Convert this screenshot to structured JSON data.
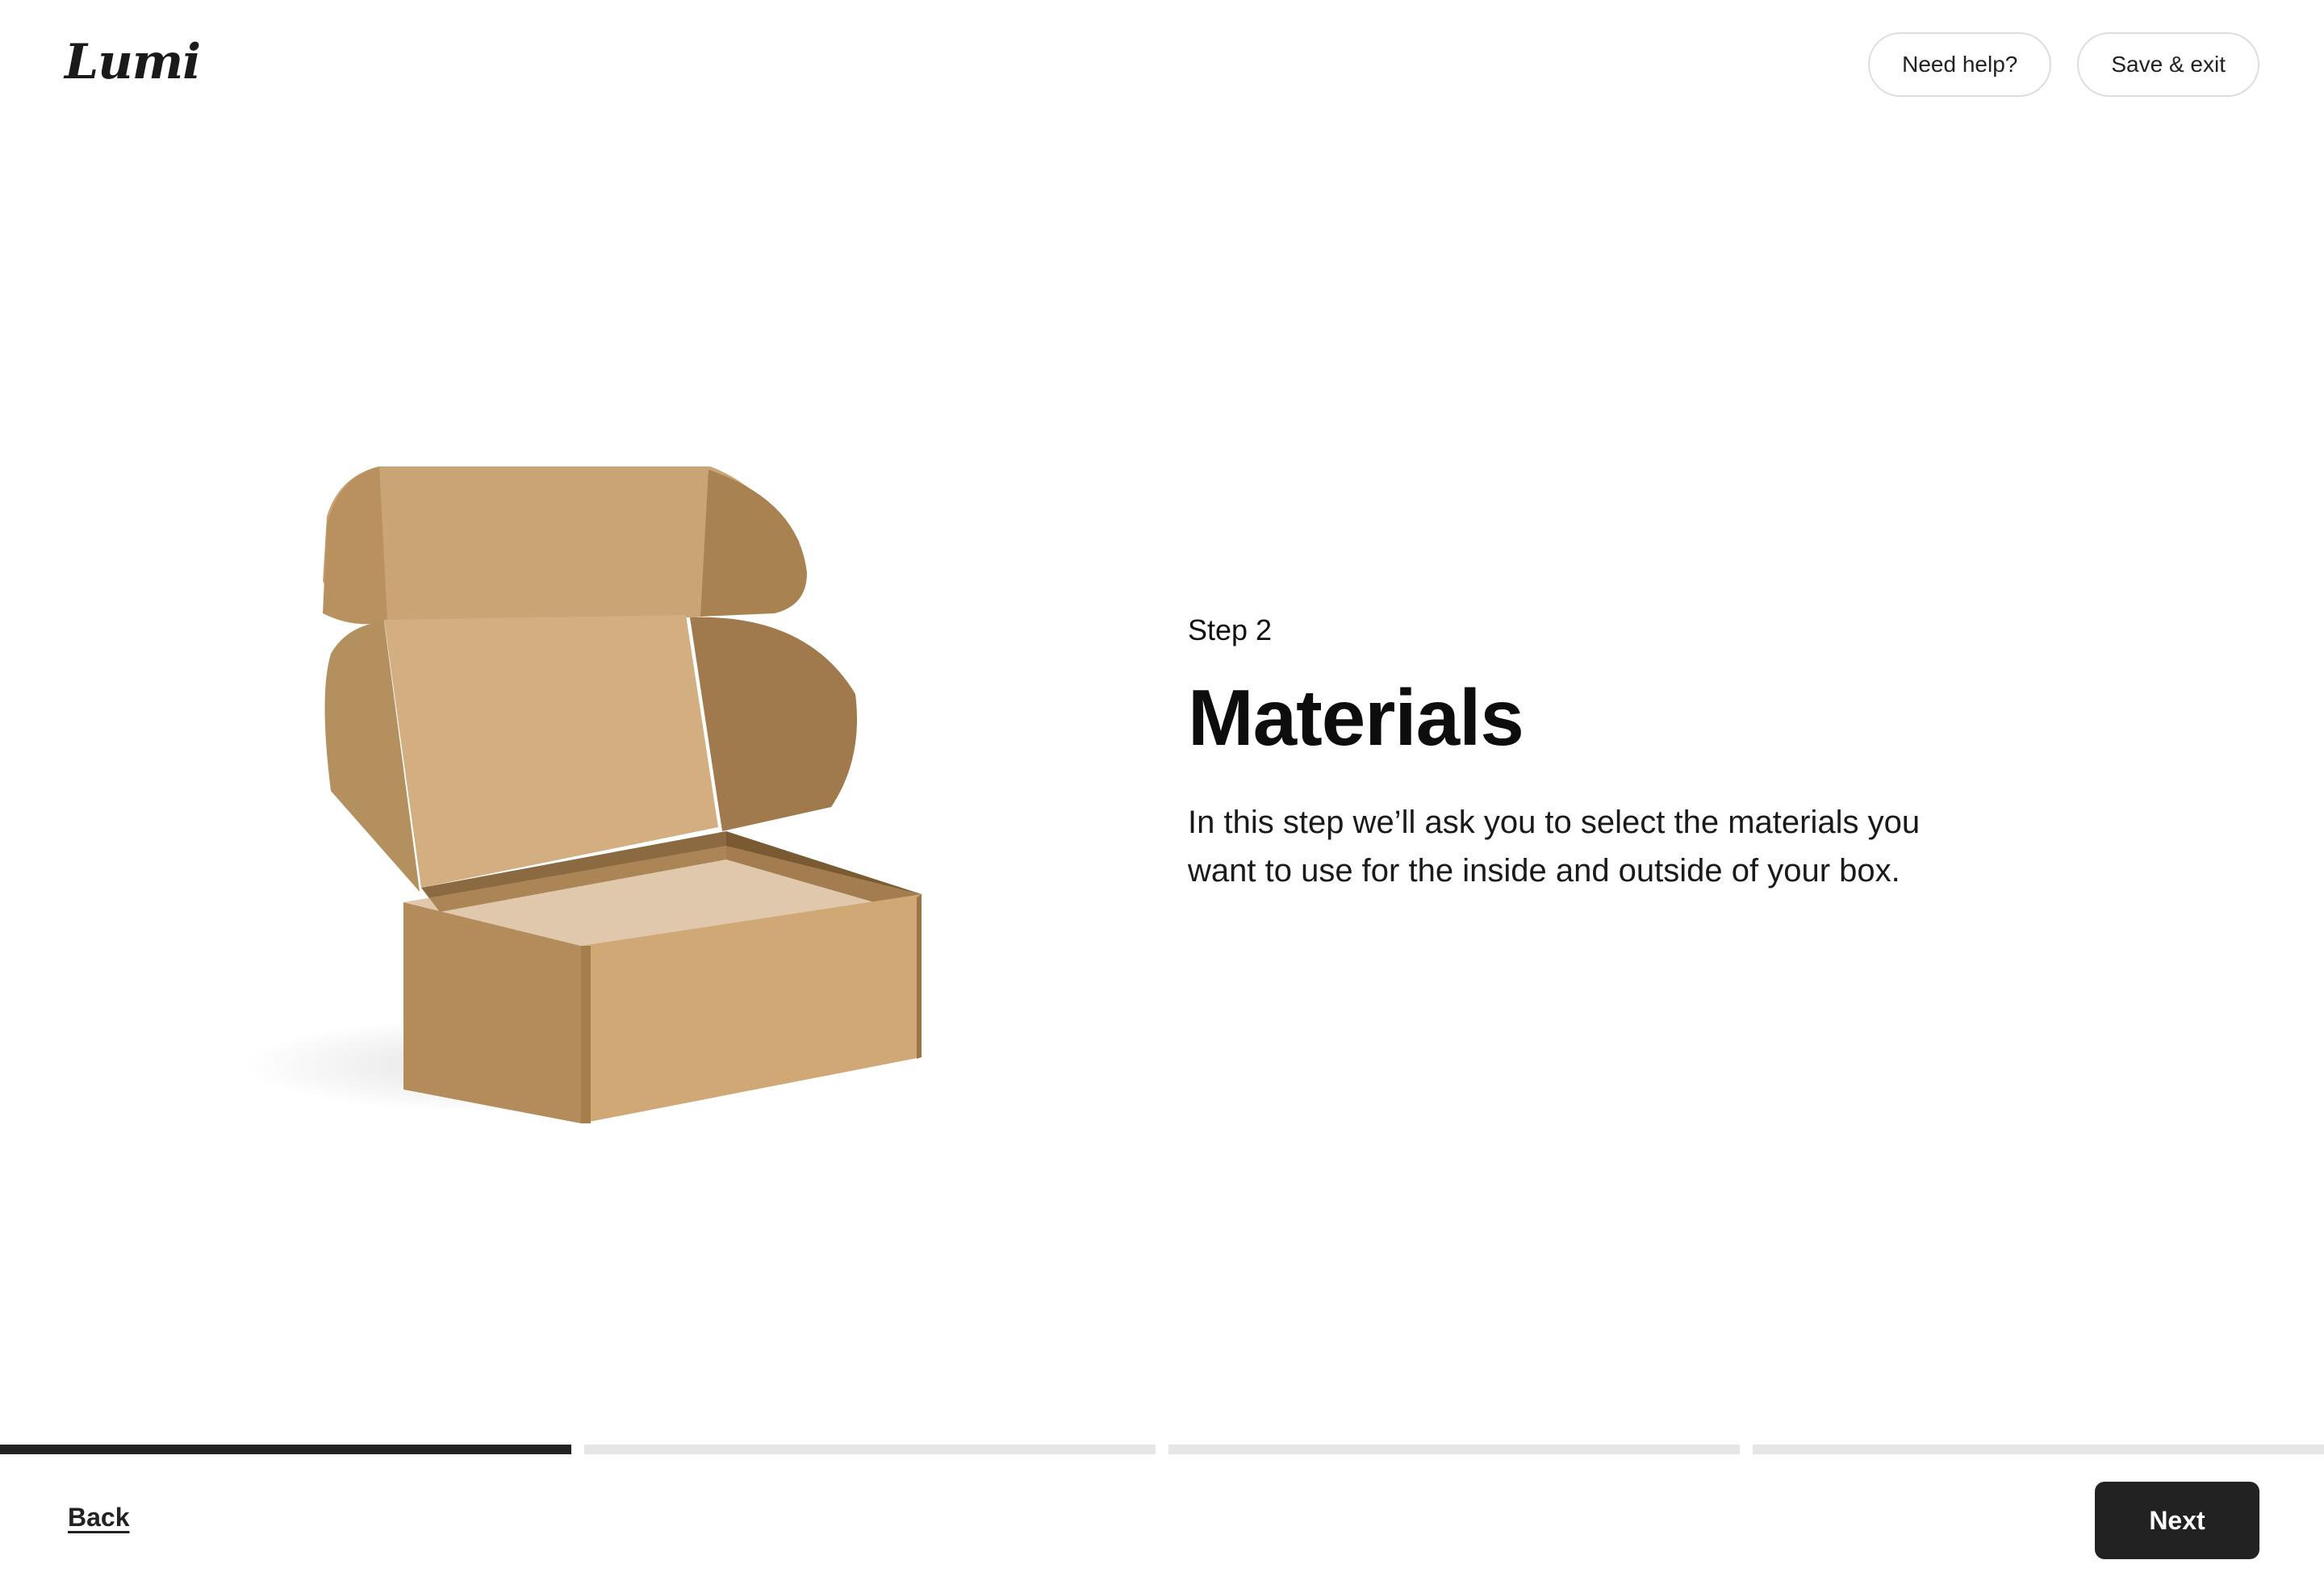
{
  "header": {
    "logo": "Lumi",
    "need_help_label": "Need help?",
    "save_exit_label": "Save & exit"
  },
  "main": {
    "illustration": "open-kraft-mailer-box",
    "step_label": "Step 2",
    "title": "Materials",
    "description": "In this step we’ll ask you to select the materials you want to use for the inside and outside of your box."
  },
  "progress": {
    "total_segments": 4,
    "active_segments": 1
  },
  "footer": {
    "back_label": "Back",
    "next_label": "Next"
  },
  "colors": {
    "accent": "#222222",
    "progress_inactive": "#e6e6e6",
    "cardboard": "#c9a474"
  }
}
